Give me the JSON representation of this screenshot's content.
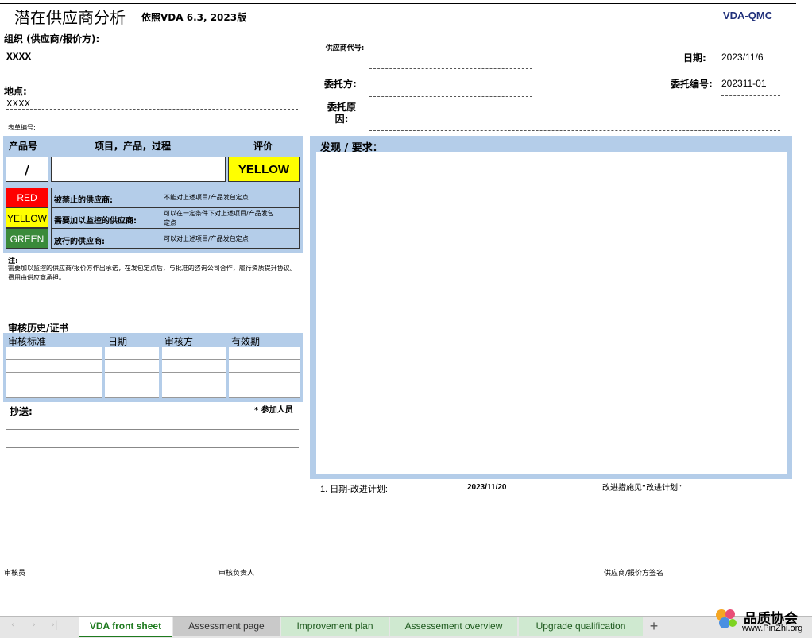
{
  "header": {
    "title": "潜在供应商分析",
    "subtitle": "依照VDA 6.3, 2023版",
    "brand": "VDA-QMC"
  },
  "org": {
    "label": "组织 (供应商/报价方):",
    "value": "XXXX"
  },
  "location": {
    "label": "地点:",
    "value": "XXXX"
  },
  "form_no": {
    "label": "表单编号:"
  },
  "supplier_code": {
    "label": "供应商代号:"
  },
  "client": {
    "label": "委托方:"
  },
  "reason": {
    "label": "委托原因:"
  },
  "date": {
    "label": "日期:",
    "value": "2023/11/6"
  },
  "commission_no": {
    "label": "委托编号:",
    "value": "202311-01"
  },
  "eval_table": {
    "col_product": "产品号",
    "col_item": "项目，产品，过程",
    "col_eval": "评价",
    "product_value": "/",
    "item_value": "",
    "eval_value": "YELLOW"
  },
  "legend": [
    {
      "color": "RED",
      "title": "被禁止的供应商:",
      "desc": "不能对上述项目/产品发包定点",
      "bg": "#ff0000",
      "fg": "#ffffff"
    },
    {
      "color": "YELLOW",
      "title": "需要加以监控的供应商:",
      "desc": "可以在一定条件下对上述项目/产品发包定点",
      "bg": "#ffff00",
      "fg": "#000000"
    },
    {
      "color": "GREEN",
      "title": "放行的供应商:",
      "desc": "可以对上述项目/产品发包定点",
      "bg": "#3a8a3a",
      "fg": "#ffffff"
    }
  ],
  "note": {
    "label": "注:",
    "text": "需要加以监控的供应商/报价方作出承诺，在发包定点后，与批准的咨询公司合作，履行资质提升协议。费用由供应商承担。"
  },
  "audit": {
    "title": "审核历史/证书",
    "cols": [
      "审核标准",
      "日期",
      "审核方",
      "有效期"
    ]
  },
  "cc": {
    "label": "抄送:",
    "participants": "* 参加人员"
  },
  "findings": {
    "label": "发现 / 要求："
  },
  "improve": {
    "label": "1. 日期-改进计划:",
    "date": "2023/11/20",
    "note": "改进措施见“改进计划”"
  },
  "signatures": {
    "auditor": "审核员",
    "lead": "审核负责人",
    "supplier": "供应商/报价方签名"
  },
  "tabs": [
    "VDA front sheet",
    "Assessment page",
    "Improvement plan",
    "Assessement overview",
    "Upgrade qualification"
  ],
  "add_tab": "+",
  "watermark": {
    "cn": "品质协会",
    "url": "www.PinZhi.org"
  },
  "colors": {
    "panel_blue": "#b4cde9",
    "tab_green": "#1e7a1e",
    "tab_inactive": "#cfe9d0"
  }
}
